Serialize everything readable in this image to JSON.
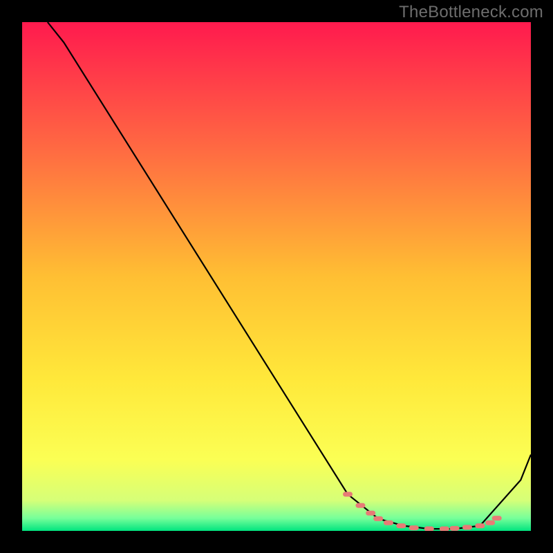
{
  "watermark": "TheBottleneck.com",
  "chart_data": {
    "type": "line",
    "title": "",
    "xlabel": "",
    "ylabel": "",
    "xlim": [
      0,
      1
    ],
    "ylim": [
      0,
      1
    ],
    "grid": false,
    "legend": false,
    "background_gradient": {
      "type": "vertical",
      "stops": [
        {
          "pos": 0.0,
          "color": "#ff1a4e"
        },
        {
          "pos": 0.25,
          "color": "#ff6a42"
        },
        {
          "pos": 0.5,
          "color": "#ffbf33"
        },
        {
          "pos": 0.7,
          "color": "#ffe83a"
        },
        {
          "pos": 0.86,
          "color": "#fbff54"
        },
        {
          "pos": 0.94,
          "color": "#d6ff78"
        },
        {
          "pos": 0.975,
          "color": "#77ff9a"
        },
        {
          "pos": 1.0,
          "color": "#00e47f"
        }
      ]
    },
    "series": [
      {
        "name": "curve",
        "stroke": "#000000",
        "x": [
          0.05,
          0.082,
          0.64,
          0.7,
          0.75,
          0.8,
          0.85,
          0.9,
          0.98,
          1.0
        ],
        "y": [
          1.0,
          0.96,
          0.072,
          0.024,
          0.01,
          0.004,
          0.004,
          0.01,
          0.1,
          0.15
        ]
      }
    ],
    "dotted_markers": {
      "stroke": "#e77b76",
      "points_x": [
        0.64,
        0.665,
        0.685,
        0.7,
        0.72,
        0.745,
        0.77,
        0.8,
        0.83,
        0.85,
        0.875,
        0.9,
        0.92,
        0.933
      ],
      "points_y": [
        0.072,
        0.05,
        0.035,
        0.024,
        0.016,
        0.01,
        0.006,
        0.004,
        0.004,
        0.005,
        0.007,
        0.01,
        0.016,
        0.025
      ]
    }
  }
}
